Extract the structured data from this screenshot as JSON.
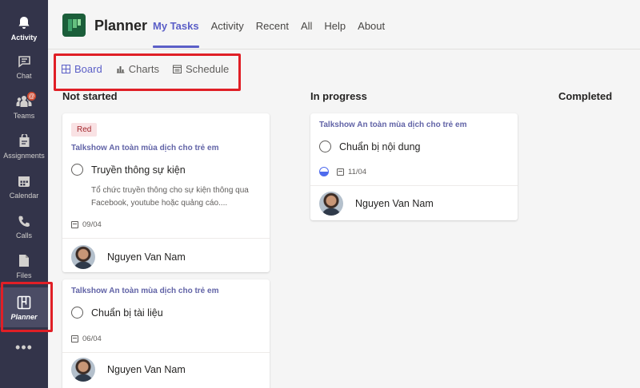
{
  "rail": {
    "items": [
      {
        "label": "Activity",
        "icon": "bell-icon"
      },
      {
        "label": "Chat",
        "icon": "chat-icon"
      },
      {
        "label": "Teams",
        "icon": "teams-icon",
        "badge": "@"
      },
      {
        "label": "Assignments",
        "icon": "assignments-icon"
      },
      {
        "label": "Calendar",
        "icon": "calendar-icon"
      },
      {
        "label": "Calls",
        "icon": "phone-icon"
      },
      {
        "label": "Files",
        "icon": "files-icon"
      },
      {
        "label": "Planner",
        "icon": "planner-icon"
      }
    ],
    "more": "•••"
  },
  "header": {
    "app_title": "Planner",
    "tabs": [
      "My Tasks",
      "Activity",
      "Recent",
      "All",
      "Help",
      "About"
    ],
    "active_tab": "My Tasks"
  },
  "views": {
    "items": [
      "Board",
      "Charts",
      "Schedule"
    ],
    "active": "Board"
  },
  "columns": {
    "not_started": "Not started",
    "in_progress": "In progress",
    "completed": "Completed"
  },
  "cards": {
    "c1": {
      "label": "Red",
      "bucket": "Talkshow An toàn mùa dịch cho trẻ em",
      "title": "Truyền thông sự kiện",
      "desc_line1": "Tổ chức truyền thông cho sự kiện thông qua",
      "desc_line2": "Facebook, youtube hoặc quảng cáo....",
      "date": "09/04",
      "assignee": "Nguyen Van Nam"
    },
    "c2": {
      "bucket": "Talkshow An toàn mùa dịch cho trẻ em",
      "title": "Chuẩn bị tài liệu",
      "date": "06/04",
      "assignee": "Nguyen Van Nam"
    },
    "c3": {
      "bucket": "Talkshow An toàn mùa dịch cho trẻ em",
      "title": "Chuẩn bị nội dung",
      "date": "11/04",
      "assignee": "Nguyen Van Nam"
    }
  },
  "colors": {
    "accent": "#5b5fc7",
    "rail": "#33344a",
    "highlight": "#e01f26",
    "label_red_bg": "#f9e2e4"
  }
}
